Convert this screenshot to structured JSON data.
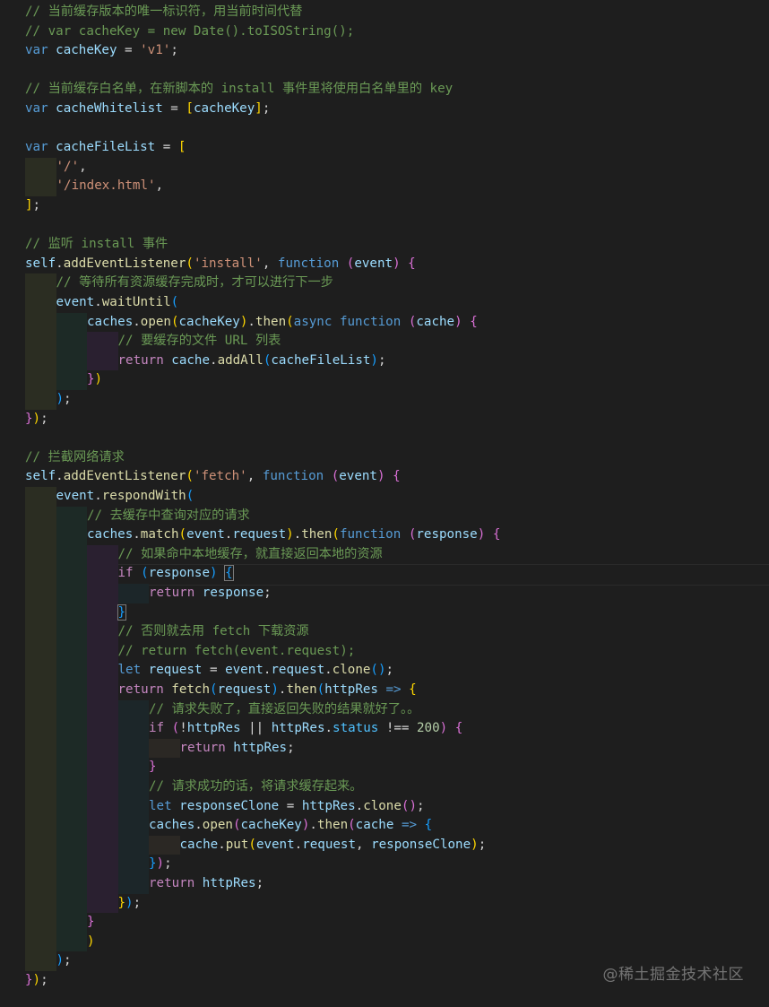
{
  "editor": {
    "lines": [
      {
        "indent": 0,
        "tokens": [
          [
            "com",
            "// 当前缓存版本的唯一标识符，用当前时间代替"
          ]
        ]
      },
      {
        "indent": 0,
        "tokens": [
          [
            "com",
            "// var cacheKey = new Date().toISOString();"
          ]
        ]
      },
      {
        "indent": 0,
        "tokens": [
          [
            "kw",
            "var"
          ],
          [
            "txt",
            " "
          ],
          [
            "var",
            "cacheKey"
          ],
          [
            "op",
            " = "
          ],
          [
            "str",
            "'v1'"
          ],
          [
            "pun",
            ";"
          ]
        ]
      },
      {
        "indent": 0,
        "tokens": []
      },
      {
        "indent": 0,
        "tokens": [
          [
            "com",
            "// 当前缓存白名单，在新脚本的 install 事件里将使用白名单里的 key"
          ]
        ]
      },
      {
        "indent": 0,
        "tokens": [
          [
            "kw",
            "var"
          ],
          [
            "txt",
            " "
          ],
          [
            "var",
            "cacheWhitelist"
          ],
          [
            "op",
            " = "
          ],
          [
            "b1",
            "["
          ],
          [
            "var",
            "cacheKey"
          ],
          [
            "b1",
            "]"
          ],
          [
            "pun",
            ";"
          ]
        ]
      },
      {
        "indent": 0,
        "tokens": []
      },
      {
        "indent": 0,
        "tokens": [
          [
            "kw",
            "var"
          ],
          [
            "txt",
            " "
          ],
          [
            "var",
            "cacheFileList"
          ],
          [
            "op",
            " = "
          ],
          [
            "b1",
            "["
          ]
        ]
      },
      {
        "indent": 1,
        "tokens": [
          [
            "str",
            "'/'"
          ],
          [
            "pun",
            ","
          ]
        ]
      },
      {
        "indent": 1,
        "tokens": [
          [
            "str",
            "'/index.html'"
          ],
          [
            "pun",
            ","
          ]
        ]
      },
      {
        "indent": 0,
        "tokens": [
          [
            "b1",
            "]"
          ],
          [
            "pun",
            ";"
          ]
        ]
      },
      {
        "indent": 0,
        "tokens": []
      },
      {
        "indent": 0,
        "tokens": [
          [
            "com",
            "// 监听 install 事件"
          ]
        ]
      },
      {
        "indent": 0,
        "tokens": [
          [
            "var",
            "self"
          ],
          [
            "pun",
            "."
          ],
          [
            "fn",
            "addEventListener"
          ],
          [
            "b1",
            "("
          ],
          [
            "str",
            "'install'"
          ],
          [
            "pun",
            ", "
          ],
          [
            "kw",
            "function"
          ],
          [
            "txt",
            " "
          ],
          [
            "b2",
            "("
          ],
          [
            "var",
            "event"
          ],
          [
            "b2",
            ")"
          ],
          [
            "txt",
            " "
          ],
          [
            "b2",
            "{"
          ]
        ]
      },
      {
        "indent": 1,
        "tokens": [
          [
            "com",
            "// 等待所有资源缓存完成时，才可以进行下一步"
          ]
        ]
      },
      {
        "indent": 1,
        "tokens": [
          [
            "var",
            "event"
          ],
          [
            "pun",
            "."
          ],
          [
            "fn",
            "waitUntil"
          ],
          [
            "b3",
            "("
          ]
        ]
      },
      {
        "indent": 2,
        "tokens": [
          [
            "var",
            "caches"
          ],
          [
            "pun",
            "."
          ],
          [
            "fn",
            "open"
          ],
          [
            "b1",
            "("
          ],
          [
            "var",
            "cacheKey"
          ],
          [
            "b1",
            ")"
          ],
          [
            "pun",
            "."
          ],
          [
            "fn",
            "then"
          ],
          [
            "b1",
            "("
          ],
          [
            "kw",
            "async"
          ],
          [
            "txt",
            " "
          ],
          [
            "kw",
            "function"
          ],
          [
            "txt",
            " "
          ],
          [
            "b2",
            "("
          ],
          [
            "var",
            "cache"
          ],
          [
            "b2",
            ")"
          ],
          [
            "txt",
            " "
          ],
          [
            "b2",
            "{"
          ]
        ]
      },
      {
        "indent": 3,
        "tokens": [
          [
            "com",
            "// 要缓存的文件 URL 列表"
          ]
        ]
      },
      {
        "indent": 3,
        "tokens": [
          [
            "ctl",
            "return"
          ],
          [
            "txt",
            " "
          ],
          [
            "var",
            "cache"
          ],
          [
            "pun",
            "."
          ],
          [
            "fn",
            "addAll"
          ],
          [
            "b3",
            "("
          ],
          [
            "var",
            "cacheFileList"
          ],
          [
            "b3",
            ")"
          ],
          [
            "pun",
            ";"
          ]
        ]
      },
      {
        "indent": 2,
        "tokens": [
          [
            "b2",
            "}"
          ],
          [
            "b1",
            ")"
          ]
        ]
      },
      {
        "indent": 1,
        "tokens": [
          [
            "b3",
            ")"
          ],
          [
            "pun",
            ";"
          ]
        ]
      },
      {
        "indent": 0,
        "tokens": [
          [
            "b2",
            "}"
          ],
          [
            "b1",
            ")"
          ],
          [
            "pun",
            ";"
          ]
        ]
      },
      {
        "indent": 0,
        "tokens": []
      },
      {
        "indent": 0,
        "tokens": [
          [
            "com",
            "// 拦截网络请求"
          ]
        ]
      },
      {
        "indent": 0,
        "tokens": [
          [
            "var",
            "self"
          ],
          [
            "pun",
            "."
          ],
          [
            "fn",
            "addEventListener"
          ],
          [
            "b1",
            "("
          ],
          [
            "str",
            "'fetch'"
          ],
          [
            "pun",
            ", "
          ],
          [
            "kw",
            "function"
          ],
          [
            "txt",
            " "
          ],
          [
            "b2",
            "("
          ],
          [
            "var",
            "event"
          ],
          [
            "b2",
            ")"
          ],
          [
            "txt",
            " "
          ],
          [
            "b2",
            "{"
          ]
        ]
      },
      {
        "indent": 1,
        "tokens": [
          [
            "var",
            "event"
          ],
          [
            "pun",
            "."
          ],
          [
            "fn",
            "respondWith"
          ],
          [
            "b3",
            "("
          ]
        ]
      },
      {
        "indent": 2,
        "tokens": [
          [
            "com",
            "// 去缓存中查询对应的请求"
          ]
        ]
      },
      {
        "indent": 2,
        "tokens": [
          [
            "var",
            "caches"
          ],
          [
            "pun",
            "."
          ],
          [
            "fn",
            "match"
          ],
          [
            "b1",
            "("
          ],
          [
            "var",
            "event"
          ],
          [
            "pun",
            "."
          ],
          [
            "var",
            "request"
          ],
          [
            "b1",
            ")"
          ],
          [
            "pun",
            "."
          ],
          [
            "fn",
            "then"
          ],
          [
            "b1",
            "("
          ],
          [
            "kw",
            "function"
          ],
          [
            "txt",
            " "
          ],
          [
            "b2",
            "("
          ],
          [
            "var",
            "response"
          ],
          [
            "b2",
            ")"
          ],
          [
            "txt",
            " "
          ],
          [
            "b2",
            "{"
          ]
        ]
      },
      {
        "indent": 3,
        "tokens": [
          [
            "com",
            "// 如果命中本地缓存，就直接返回本地的资源"
          ]
        ]
      },
      {
        "indent": 3,
        "cursor": true,
        "tokens": [
          [
            "ctl",
            "if"
          ],
          [
            "txt",
            " "
          ],
          [
            "b3",
            "("
          ],
          [
            "var",
            "response"
          ],
          [
            "b3",
            ")"
          ],
          [
            "txt",
            " "
          ],
          [
            "b3m",
            "{"
          ]
        ]
      },
      {
        "indent": 4,
        "tokens": [
          [
            "ctl",
            "return"
          ],
          [
            "txt",
            " "
          ],
          [
            "var",
            "response"
          ],
          [
            "pun",
            ";"
          ]
        ]
      },
      {
        "indent": 3,
        "tokens": [
          [
            "b3m",
            "}"
          ]
        ]
      },
      {
        "indent": 3,
        "tokens": [
          [
            "com",
            "// 否则就去用 fetch 下载资源"
          ]
        ]
      },
      {
        "indent": 3,
        "tokens": [
          [
            "com",
            "// return fetch(event.request);"
          ]
        ]
      },
      {
        "indent": 3,
        "tokens": [
          [
            "kw",
            "let"
          ],
          [
            "txt",
            " "
          ],
          [
            "var",
            "request"
          ],
          [
            "op",
            " = "
          ],
          [
            "var",
            "event"
          ],
          [
            "pun",
            "."
          ],
          [
            "var",
            "request"
          ],
          [
            "pun",
            "."
          ],
          [
            "fn",
            "clone"
          ],
          [
            "b3",
            "()"
          ],
          [
            "pun",
            ";"
          ]
        ]
      },
      {
        "indent": 3,
        "tokens": [
          [
            "ctl",
            "return"
          ],
          [
            "txt",
            " "
          ],
          [
            "fn",
            "fetch"
          ],
          [
            "b3",
            "("
          ],
          [
            "var",
            "request"
          ],
          [
            "b3",
            ")"
          ],
          [
            "pun",
            "."
          ],
          [
            "fn",
            "then"
          ],
          [
            "b3",
            "("
          ],
          [
            "var",
            "httpRes"
          ],
          [
            "txt",
            " "
          ],
          [
            "kw",
            "=>"
          ],
          [
            "txt",
            " "
          ],
          [
            "b1",
            "{"
          ]
        ]
      },
      {
        "indent": 4,
        "tokens": [
          [
            "com",
            "// 请求失败了，直接返回失败的结果就好了。。"
          ]
        ]
      },
      {
        "indent": 4,
        "tokens": [
          [
            "ctl",
            "if"
          ],
          [
            "txt",
            " "
          ],
          [
            "b2",
            "("
          ],
          [
            "op",
            "!"
          ],
          [
            "var",
            "httpRes"
          ],
          [
            "op",
            " || "
          ],
          [
            "var",
            "httpRes"
          ],
          [
            "pun",
            "."
          ],
          [
            "prop",
            "status"
          ],
          [
            "op",
            " !== "
          ],
          [
            "num",
            "200"
          ],
          [
            "b2",
            ")"
          ],
          [
            "txt",
            " "
          ],
          [
            "b2",
            "{"
          ]
        ]
      },
      {
        "indent": 5,
        "tokens": [
          [
            "ctl",
            "return"
          ],
          [
            "txt",
            " "
          ],
          [
            "var",
            "httpRes"
          ],
          [
            "pun",
            ";"
          ]
        ]
      },
      {
        "indent": 4,
        "tokens": [
          [
            "b2",
            "}"
          ]
        ]
      },
      {
        "indent": 4,
        "tokens": [
          [
            "com",
            "// 请求成功的话，将请求缓存起来。"
          ]
        ]
      },
      {
        "indent": 4,
        "tokens": [
          [
            "kw",
            "let"
          ],
          [
            "txt",
            " "
          ],
          [
            "var",
            "responseClone"
          ],
          [
            "op",
            " = "
          ],
          [
            "var",
            "httpRes"
          ],
          [
            "pun",
            "."
          ],
          [
            "fn",
            "clone"
          ],
          [
            "b2",
            "()"
          ],
          [
            "pun",
            ";"
          ]
        ]
      },
      {
        "indent": 4,
        "tokens": [
          [
            "var",
            "caches"
          ],
          [
            "pun",
            "."
          ],
          [
            "fn",
            "open"
          ],
          [
            "b2",
            "("
          ],
          [
            "var",
            "cacheKey"
          ],
          [
            "b2",
            ")"
          ],
          [
            "pun",
            "."
          ],
          [
            "fn",
            "then"
          ],
          [
            "b2",
            "("
          ],
          [
            "var",
            "cache"
          ],
          [
            "txt",
            " "
          ],
          [
            "kw",
            "=>"
          ],
          [
            "txt",
            " "
          ],
          [
            "b3",
            "{"
          ]
        ]
      },
      {
        "indent": 5,
        "tokens": [
          [
            "var",
            "cache"
          ],
          [
            "pun",
            "."
          ],
          [
            "fn",
            "put"
          ],
          [
            "b1",
            "("
          ],
          [
            "var",
            "event"
          ],
          [
            "pun",
            "."
          ],
          [
            "var",
            "request"
          ],
          [
            "pun",
            ", "
          ],
          [
            "var",
            "responseClone"
          ],
          [
            "b1",
            ")"
          ],
          [
            "pun",
            ";"
          ]
        ]
      },
      {
        "indent": 4,
        "tokens": [
          [
            "b3",
            "}"
          ],
          [
            "b2",
            ")"
          ],
          [
            "pun",
            ";"
          ]
        ]
      },
      {
        "indent": 4,
        "tokens": [
          [
            "ctl",
            "return"
          ],
          [
            "txt",
            " "
          ],
          [
            "var",
            "httpRes"
          ],
          [
            "pun",
            ";"
          ]
        ]
      },
      {
        "indent": 3,
        "tokens": [
          [
            "b1",
            "}"
          ],
          [
            "b3",
            ")"
          ],
          [
            "pun",
            ";"
          ]
        ]
      },
      {
        "indent": 2,
        "tokens": [
          [
            "b2",
            "}"
          ]
        ]
      },
      {
        "indent": 2,
        "tokens": [
          [
            "b1",
            ")"
          ]
        ]
      },
      {
        "indent": 1,
        "tokens": [
          [
            "b3",
            ")"
          ],
          [
            "pun",
            ";"
          ]
        ]
      },
      {
        "indent": 0,
        "tokens": [
          [
            "b2",
            "}"
          ],
          [
            "b1",
            ")"
          ],
          [
            "pun",
            ";"
          ]
        ]
      }
    ]
  },
  "watermark": "@稀土掘金技术社区"
}
